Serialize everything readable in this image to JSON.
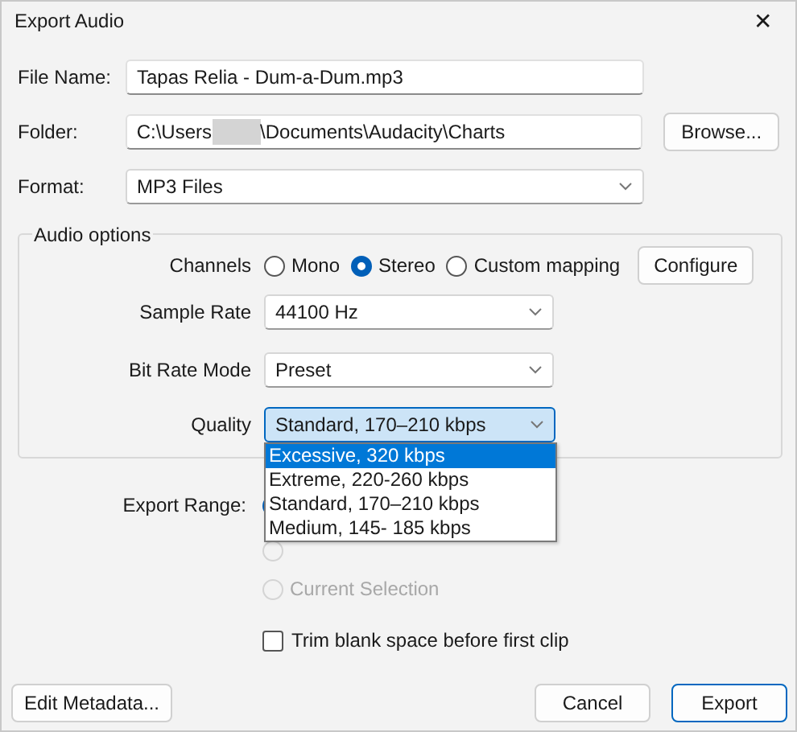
{
  "window": {
    "title": "Export Audio",
    "close": "✕"
  },
  "file_name": {
    "label": "File Name:",
    "value": "Tapas Relia - Dum-a-Dum.mp3"
  },
  "folder": {
    "label": "Folder:",
    "value_before": "C:\\Users",
    "value_after": "\\Documents\\Audacity\\Charts",
    "redacted": true,
    "button": "Browse..."
  },
  "format": {
    "label": "Format:",
    "value": "MP3 Files"
  },
  "audio_options": {
    "title": "Audio options",
    "channels": {
      "label": "Channels",
      "options": [
        {
          "label": "Mono",
          "selected": false
        },
        {
          "label": "Stereo",
          "selected": true
        },
        {
          "label": "Custom mapping",
          "selected": false
        }
      ],
      "button": "Configure"
    },
    "sample_rate": {
      "label": "Sample Rate",
      "value": "44100 Hz"
    },
    "bit_rate_mode": {
      "label": "Bit Rate Mode",
      "value": "Preset"
    },
    "quality": {
      "label": "Quality",
      "value": "Standard, 170–210 kbps",
      "expanded": true,
      "options": [
        {
          "label": "Excessive, 320 kbps",
          "highlighted": true
        },
        {
          "label": "Extreme, 220-260 kbps",
          "highlighted": false
        },
        {
          "label": "Standard, 170–210 kbps",
          "highlighted": false
        },
        {
          "label": "Medium, 145- 185 kbps",
          "highlighted": false
        }
      ]
    }
  },
  "export_range": {
    "label": "Export Range:",
    "options": [
      {
        "selected": true
      },
      {
        "selected": false,
        "disabled": true
      },
      {
        "label": "Current Selection",
        "selected": false,
        "disabled": true
      }
    ]
  },
  "trim": {
    "label": "Trim blank space before first clip",
    "checked": false
  },
  "buttons": [
    {
      "label": "Edit Metadata...",
      "default": false
    },
    {
      "label": "Cancel",
      "default": false
    },
    {
      "label": "Export",
      "default": true
    }
  ]
}
